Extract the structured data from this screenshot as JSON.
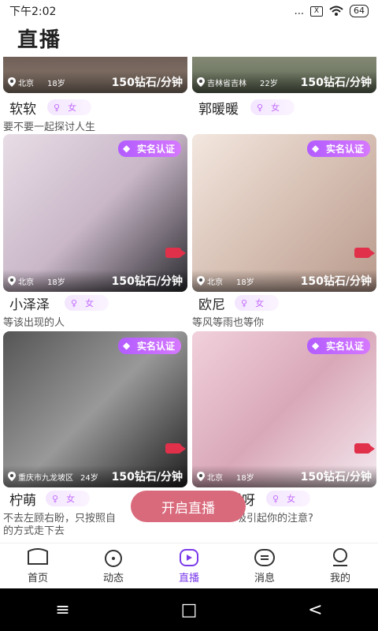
{
  "status_bar": {
    "time": "下午2:02",
    "battery": "64",
    "signal": "...",
    "x_icon_label": "X"
  },
  "page": {
    "title": "直播"
  },
  "colors": {
    "accent": "#7b3aea",
    "badge": "#c070ff",
    "live_button": "#d96a7c",
    "camera": "#e0304a"
  },
  "cards": [
    {
      "location": "北京",
      "age": "18岁",
      "price": "150钻石/分钟",
      "name": "软软",
      "gender": "女",
      "signature": "要不要一起探讨人生",
      "verified": false,
      "camera": false
    },
    {
      "location": "吉林省吉林",
      "age": "22岁",
      "price": "150钻石/分钟",
      "name": "郭暖暖",
      "gender": "女",
      "signature": "",
      "verified": false,
      "camera": false
    },
    {
      "location": "北京",
      "age": "18岁",
      "price": "150钻石/分钟",
      "name": "小泽泽",
      "gender": "女",
      "signature": "等该出现的人",
      "verified": true,
      "verified_label": "实名认证",
      "camera": true
    },
    {
      "location": "北京",
      "age": "18岁",
      "price": "150钻石/分钟",
      "name": "欧尼",
      "gender": "女",
      "signature": "等风等雨也等你",
      "verified": true,
      "verified_label": "实名认证",
      "camera": true
    },
    {
      "location": "重庆市九龙坡区",
      "age": "24岁",
      "price": "150钻石/分钟",
      "name": "柠萌",
      "gender": "女",
      "signature": "不去左顾右盼，只按照自",
      "verified": true,
      "verified_label": "实名认证",
      "camera": true
    },
    {
      "location": "北京",
      "age": "18岁",
      "price": "150钻石/分钟",
      "name": "暖呀",
      "gender": "女",
      "signature": "吸引起你的注意?",
      "verified": true,
      "verified_label": "实名认证",
      "camera": true
    }
  ],
  "signature_line2": "的方式走下去",
  "live_button": {
    "label": "开启直播"
  },
  "tabs": [
    {
      "label": "首页",
      "icon": "home-icon"
    },
    {
      "label": "动态",
      "icon": "moments-icon"
    },
    {
      "label": "直播",
      "icon": "live-icon",
      "active": true
    },
    {
      "label": "消息",
      "icon": "message-icon"
    },
    {
      "label": "我的",
      "icon": "profile-icon"
    }
  ],
  "nav": {
    "menu": "≡",
    "home": "□",
    "back": "<"
  }
}
